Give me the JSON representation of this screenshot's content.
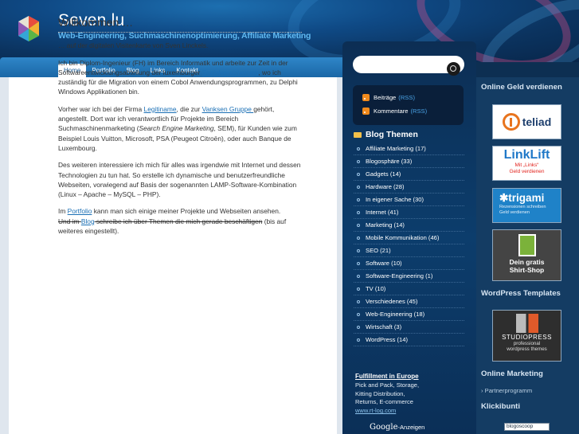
{
  "header": {
    "title": "Seven.lu",
    "tagline": "Web-Engineering, Suchmaschinenoptimierung, Affiliate Marketing"
  },
  "nav": {
    "items": [
      "Home",
      "Portfolio",
      "Blog",
      "Links",
      "Kontakt"
    ],
    "active": "Home"
  },
  "content": {
    "heading": "Willkommen …",
    "p1": "… auf der digitalen Visitenkarte von Sven Linckels.",
    "p2_a": "Ich bin Diplom-Ingenieur (FH) im Bereich Informatik und arbeite zur Zeit in der Softwareentwicklungsabteilung der luxemburger ",
    "p2_link": "Sozialversicherung",
    "p2_b": ", wo ich zuständig für die Migration von einem Cobol Anwendungsprogrammen, zu Delphi Windows Applikationen bin.",
    "p3_a": "Vorher war ich bei der Firma ",
    "p3_link1": "Legitiname",
    "p3_b": ", die zur ",
    "p3_link2": "Vanksen Gruppe ",
    "p3_c": "gehört, angestellt. Dort war ich verantwortlich für Projekte im Bereich Suchmaschinenmarketing (",
    "p3_em": "Search Engine Marketing",
    "p3_d": ", SEM), für Kunden wie zum Beispiel Louis Vuitton, Microsoft, PSA (Peugeot Citroën), oder auch Banque de Luxembourg.",
    "p4": "Des weiteren interessiere ich mich für alles was irgendwie mit Internet und dessen Technologien zu tun hat. So erstelle ich dynamische und benutzerfreundliche Webseiten, vorwiegend auf Basis der sogenannten LAMP-Software-Kombination (Linux – Apache – MySQL – PHP).",
    "p5_a": "Im ",
    "p5_link1": "Portfolio",
    "p5_b": " kann man sich einige meiner Projekte und Webseiten ansehen.",
    "p5_strike1": "Und im ",
    "p5_link2": "Blog",
    "p5_strike2": " schreibe ich über Themen die mich gerade beschäftigen",
    "p5_c": " (bis auf weiteres eingestellt)."
  },
  "search": {
    "placeholder": ""
  },
  "rss": {
    "posts_label": "Beiträge",
    "comments_label": "Kommentare",
    "rss_tag": "(RSS)"
  },
  "blog_themen": {
    "title": "Blog Themen",
    "categories": [
      "Affiliate Marketing (17)",
      "Blogosphäre (33)",
      "Gadgets (14)",
      "Hardware (28)",
      "In eigener Sache (30)",
      "Internet (41)",
      "Marketing (14)",
      "Mobile Kommunikation (46)",
      "SEO (21)",
      "Software (10)",
      "Software-Engineering (1)",
      "TV (10)",
      "Verschiedenes (45)",
      "Web-Engineering (18)",
      "Wirtschaft (3)",
      "WordPress (14)"
    ]
  },
  "google_ad": {
    "title": "Fulfillment in Europe",
    "line1": "Pick and Pack, Storage,",
    "line2": "Kitting Distribution,",
    "line3": "Returns, E-commerce",
    "url": "www.rt-log.com",
    "google_label": "Google",
    "ads_label": "-Anzeigen"
  },
  "right": {
    "online_geld_title": "Online Geld verdienen",
    "teliad": "teliad",
    "linklift_name": "LinkLift",
    "linklift_sub1": "Mit „Links“",
    "linklift_sub2": "Geld verdienen",
    "trigami_name": "✱trigami",
    "trigami_sub1": "Rezensionen schreiben",
    "trigami_sub2": "Geld verdienen",
    "spread_line1": "Dein gratis",
    "spread_line2": "Shirt-Shop",
    "wp_templates_title": "WordPress Templates",
    "studio_name": "STUDIOPRESS",
    "studio_sub1": "professional",
    "studio_sub2": "wordpress themes",
    "online_marketing_title": "Online Marketing",
    "partner_link": "Partnerprogramm",
    "klickibunti_title": "Klickibunti",
    "blogoscoop_badge": "blogoscoop"
  }
}
